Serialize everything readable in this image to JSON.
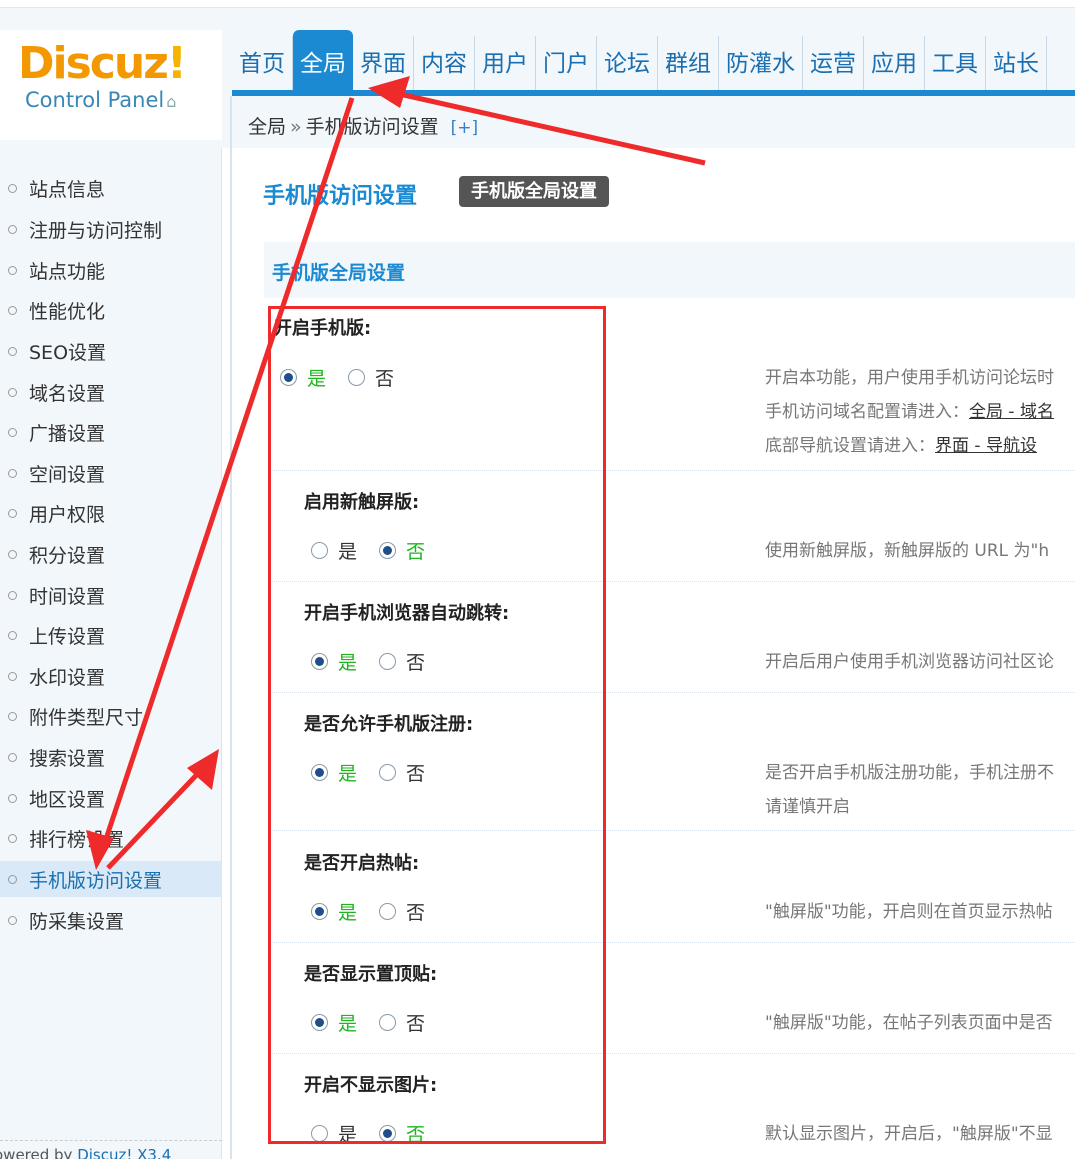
{
  "logo": {
    "word": "Discuz",
    "bang": "!",
    "sub": "Control Panel"
  },
  "nav": [
    {
      "label": "首页",
      "active": false
    },
    {
      "label": "全局",
      "active": true
    },
    {
      "label": "界面",
      "active": false
    },
    {
      "label": "内容",
      "active": false
    },
    {
      "label": "用户",
      "active": false
    },
    {
      "label": "门户",
      "active": false
    },
    {
      "label": "论坛",
      "active": false
    },
    {
      "label": "群组",
      "active": false
    },
    {
      "label": "防灌水",
      "active": false
    },
    {
      "label": "运营",
      "active": false
    },
    {
      "label": "应用",
      "active": false
    },
    {
      "label": "工具",
      "active": false
    },
    {
      "label": "站长",
      "active": false
    }
  ],
  "breadcrumb": {
    "root": "全局",
    "sep": "»",
    "current": "手机版访问设置",
    "plus": "[+]"
  },
  "sidebar": {
    "items": [
      "站点信息",
      "注册与访问控制",
      "站点功能",
      "性能优化",
      "SEO设置",
      "域名设置",
      "广播设置",
      "空间设置",
      "用户权限",
      "积分设置",
      "时间设置",
      "上传设置",
      "水印设置",
      "附件类型尺寸",
      "搜索设置",
      "地区设置",
      "排行榜设置",
      "手机版访问设置",
      "防采集设置"
    ],
    "active_index": 17,
    "powered": "owered by ",
    "powered_link": "Discuz! X3.4"
  },
  "main": {
    "page_title": "手机版访问设置",
    "page_tab": "手机版全局设置",
    "section_title": "手机版全局设置",
    "yes": "是",
    "no": "否"
  },
  "settings": [
    {
      "label": "开启手机版:",
      "value": "yes",
      "desc": [
        "开启本功能，用户使用手机访问论坛时",
        "手机访问域名配置请进入：",
        "底部导航设置请进入："
      ],
      "links": [
        "全局 - 域名",
        "界面 - 导航设"
      ]
    },
    {
      "label": "启用新触屏版:",
      "value": "no",
      "desc": [
        "使用新触屏版，新触屏版的 URL 为\"h"
      ]
    },
    {
      "label": "开启手机浏览器自动跳转:",
      "value": "yes",
      "desc": [
        "开启后用户使用手机浏览器访问社区论"
      ]
    },
    {
      "label": "是否允许手机版注册:",
      "value": "yes",
      "desc": [
        "是否开启手机版注册功能，手机注册不",
        "请谨慎开启"
      ]
    },
    {
      "label": "是否开启热帖:",
      "value": "yes",
      "desc": [
        "\"触屏版\"功能，开启则在首页显示热帖"
      ]
    },
    {
      "label": "是否显示置顶贴:",
      "value": "yes",
      "desc": [
        "\"触屏版\"功能，在帖子列表页面中是否"
      ]
    },
    {
      "label": "开启不显示图片:",
      "value": "no",
      "desc": [
        "默认显示图片，开启后，\"触屏版\"不显"
      ]
    }
  ],
  "colors": {
    "accent": "#1b8ad3",
    "annotation": "#ee2a2a",
    "selected": "#1fb51f"
  }
}
